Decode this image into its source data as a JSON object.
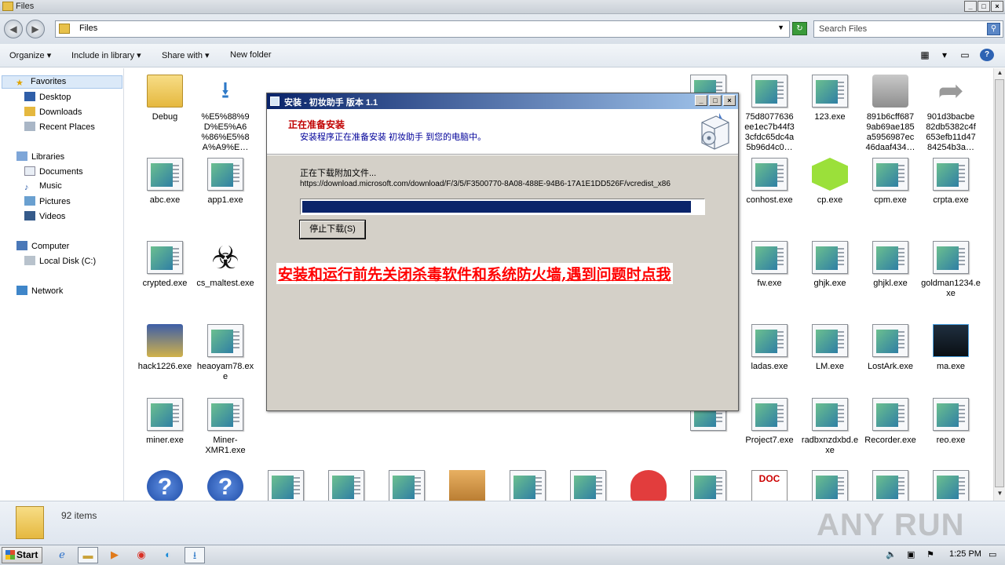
{
  "window": {
    "title": "Files"
  },
  "addressbar": {
    "path": "Files",
    "search_placeholder": "Search Files"
  },
  "toolbar": {
    "organize": "Organize",
    "include": "Include in library",
    "share": "Share with",
    "new_folder": "New folder"
  },
  "nav": {
    "favorites": "Favorites",
    "desktop": "Desktop",
    "downloads": "Downloads",
    "recent": "Recent Places",
    "libraries": "Libraries",
    "documents": "Documents",
    "music": "Music",
    "pictures": "Pictures",
    "videos": "Videos",
    "computer": "Computer",
    "local_disk": "Local Disk (C:)",
    "network": "Network"
  },
  "files": {
    "f_debug": "Debug",
    "f_enc": "%E5%88%9 D%E5%A6 %86%E5%8 A%A9%E…",
    "f_75d": "75d8077636 ee1ec7b44f3 3cfdc65dc4a 5b96d4c0…",
    "f_123": "123.exe",
    "f_891": "891b6cff687 9ab69ae185 a5956987ec 46daaf434…",
    "f_901": "901d3bacbe 82db5382c4f 653efb11d47 84254b3a…",
    "f_abc": "abc.exe",
    "f_app1": "app1.exe",
    "f_conhost": "conhost.exe",
    "f_cp": "cp.exe",
    "f_cpm": "cpm.exe",
    "f_crpta": "crpta.exe",
    "f_crypted": "crypted.exe",
    "f_cs": "cs_maltest.exe",
    "f_fw": "fw.exe",
    "f_ghjk": "ghjk.exe",
    "f_ghjkl": "ghjkl.exe",
    "f_goldman": "goldman1234.exe",
    "f_hack": "hack1226.exe",
    "f_heao": "heaoyam78.exe",
    "f_ladas": "ladas.exe",
    "f_lm": "LM.exe",
    "f_lostark": "LostArk.exe",
    "f_ma": "ma.exe",
    "f_miner": "miner.exe",
    "f_minerx": "Miner-XMR1.exe",
    "f_p7": "Project7.exe",
    "f_radb": "radbxnzdxbd.exe",
    "f_rec": "Recorder.exe",
    "f_reo": "reo.exe"
  },
  "status": {
    "count": "92 items",
    "watermark": "ANY RUN"
  },
  "taskbar": {
    "start": "Start",
    "time": "1:25 PM"
  },
  "dialog": {
    "title": "安装 - 初妆助手 版本 1.1",
    "heading": "正在准备安装",
    "subheading": "安装程序正在准备安装 初妆助手 到您的电脑中。",
    "download_label": "正在下载附加文件...",
    "download_url": "https://download.microsoft.com/download/F/3/5/F3500770-8A08-488E-94B6-17A1E1DD526F/vcredist_x86",
    "progress_percent": 97,
    "stop_button": "停止下载(S)",
    "warning": "安装和运行前先关闭杀毒软件和系统防火墙,遇到问题时点我"
  },
  "colors": {
    "dialog_title": "#0a246a",
    "warning_red": "#ff0000",
    "progress": "#0a246a"
  }
}
